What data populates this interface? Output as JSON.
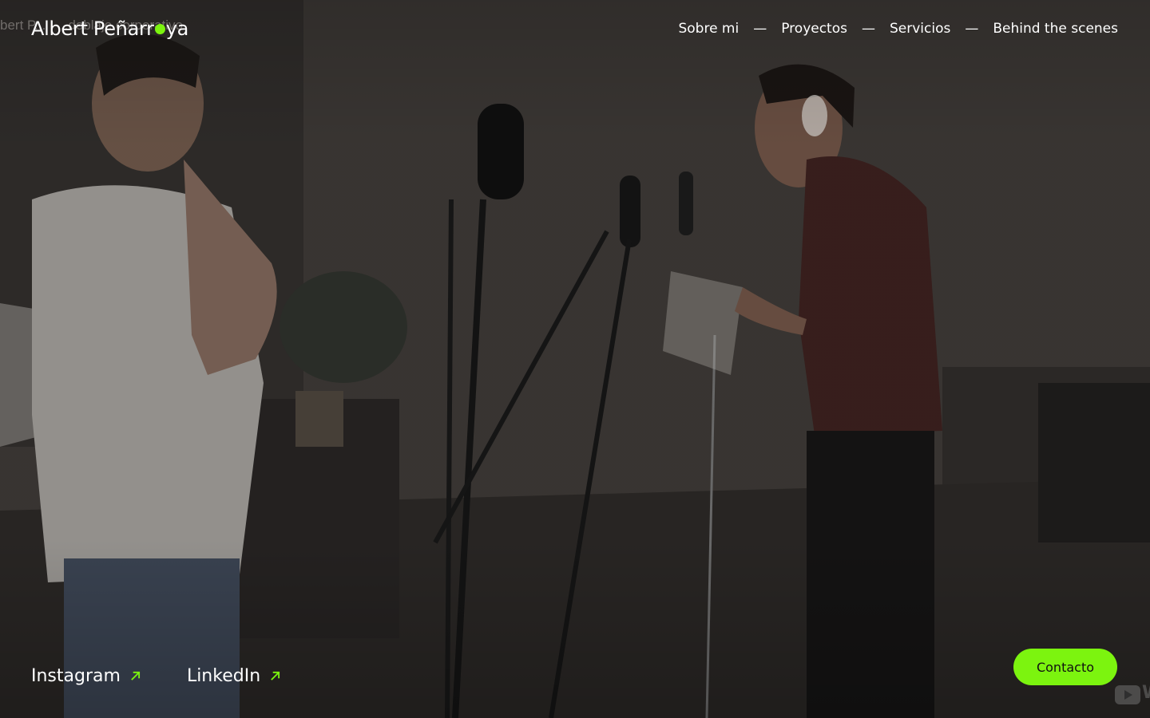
{
  "video": {
    "title": "bert P... | ...doblaje corporativo"
  },
  "header": {
    "logo_before": "Albert Peñarr",
    "logo_after": "ya",
    "nav": [
      {
        "label": "Sobre mi"
      },
      {
        "label": "Proyectos"
      },
      {
        "label": "Servicios"
      },
      {
        "label": "Behind the scenes"
      }
    ],
    "separator": "—"
  },
  "social": [
    {
      "label": "Instagram",
      "icon": "arrow-up-right-icon"
    },
    {
      "label": "LinkedIn",
      "icon": "arrow-up-right-icon"
    }
  ],
  "contact": {
    "label": "Contacto"
  },
  "colors": {
    "accent": "#7cf40f",
    "text": "#ffffff"
  }
}
